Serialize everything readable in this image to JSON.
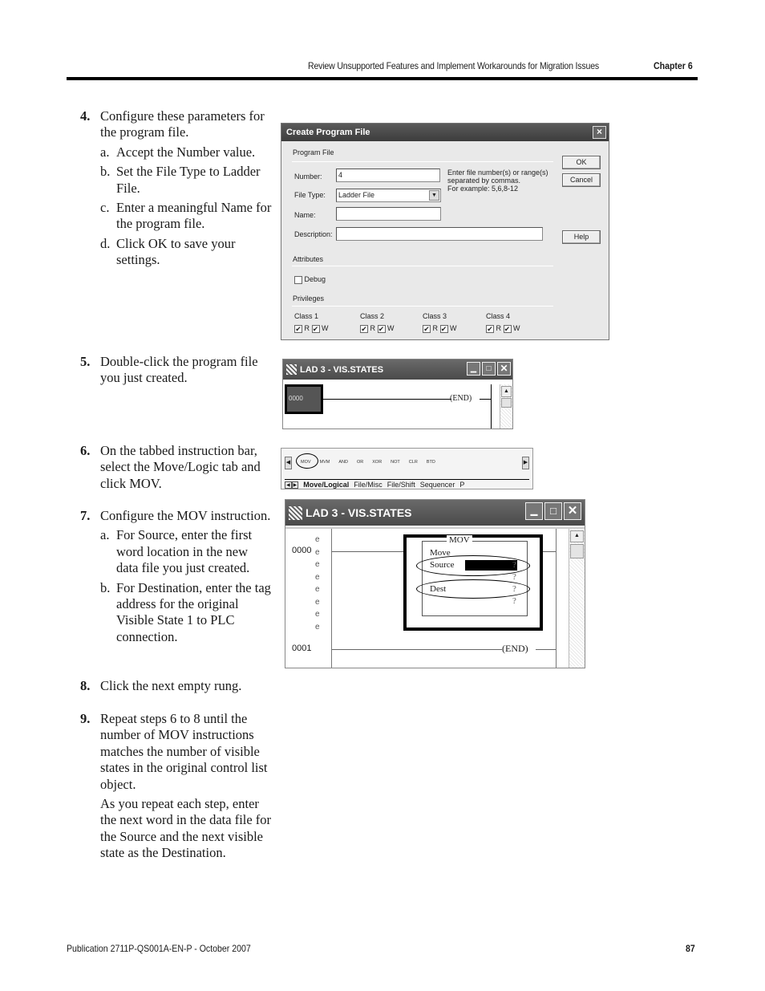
{
  "header": {
    "title": "Review Unsupported Features and Implement Workarounds for Migration Issues",
    "chapter": "Chapter 6"
  },
  "steps": [
    {
      "num": "4.",
      "text": "Configure these parameters for the program file.",
      "subs": [
        {
          "label": "a.",
          "text": "Accept the Number value."
        },
        {
          "label": "b.",
          "text": "Set the File Type to Ladder File."
        },
        {
          "label": "c.",
          "text": "Enter a meaningful Name for the program file."
        },
        {
          "label": "d.",
          "text": "Click OK to save your settings."
        }
      ]
    },
    {
      "num": "5.",
      "text": "Double-click the program file you just created."
    },
    {
      "num": "6.",
      "text": "On the tabbed instruction bar, select the Move/Logic tab and click MOV."
    },
    {
      "num": "7.",
      "text": "Configure the MOV instruction.",
      "subs": [
        {
          "label": "a.",
          "text": "For Source, enter the first word location in the new data file you just created."
        },
        {
          "label": "b.",
          "text": "For Destination, enter the tag address for the original Visible State 1 to PLC connection."
        }
      ]
    },
    {
      "num": "8.",
      "text": "Click the next empty rung."
    },
    {
      "num": "9.",
      "text": "Repeat steps 6 to 8 until the number of MOV instructions matches the number of visible states in the original control list object.",
      "para": "As you repeat each step, enter the next word in the data file for the Source and the next visible state as the Destination."
    }
  ],
  "dialog": {
    "title": "Create Program File",
    "close_icon": "×",
    "group_program_file": "Program File",
    "number_label": "Number:",
    "number_value": "4",
    "hint": [
      "Enter file number(s) or range(s)",
      "separated by commas.",
      "For example: 5,6,8-12"
    ],
    "filetype_label": "File Type:",
    "filetype_value": "Ladder File",
    "name_label": "Name:",
    "name_value": "",
    "description_label": "Description:",
    "description_value": "",
    "ok": "OK",
    "cancel": "Cancel",
    "help": "Help",
    "group_attributes": "Attributes",
    "debug_label": "Debug",
    "debug_checked": false,
    "group_privileges": "Privileges",
    "classes": [
      {
        "label": "Class 1",
        "r": "R",
        "w": "W",
        "r_checked": true,
        "w_checked": true
      },
      {
        "label": "Class 2",
        "r": "R",
        "w": "W",
        "r_checked": true,
        "w_checked": true
      },
      {
        "label": "Class 3",
        "r": "R",
        "w": "W",
        "r_checked": true,
        "w_checked": true
      },
      {
        "label": "Class 4",
        "r": "R",
        "w": "W",
        "r_checked": true,
        "w_checked": true
      }
    ]
  },
  "lad_small": {
    "title": "LAD 3 - VIS.STATES",
    "rung": "0000",
    "end": "END"
  },
  "tabbar": {
    "instructions": [
      "MOV",
      "MVM",
      "AND",
      "OR",
      "XOR",
      "NOT",
      "CLR",
      "BTD"
    ],
    "tabs": [
      "Move/Logical",
      "File/Misc",
      "File/Shift",
      "Sequencer",
      "P"
    ]
  },
  "lad_large": {
    "title": "LAD 3 - VIS.STATES",
    "rung0": "0000",
    "rung1": "0001",
    "e_marks": [
      "e",
      "e",
      "e",
      "e",
      "e",
      "e",
      "e",
      "e"
    ],
    "mov_title": "MOV",
    "mov_desc": "Move",
    "source_label": "Source",
    "source_q": "?",
    "source_q2": "?",
    "dest_label": "Dest",
    "dest_q": "?",
    "dest_q2": "?",
    "end": "END"
  },
  "footer": {
    "publication": "Publication 2711P-QS001A-EN-P - October 2007",
    "page": "87"
  }
}
